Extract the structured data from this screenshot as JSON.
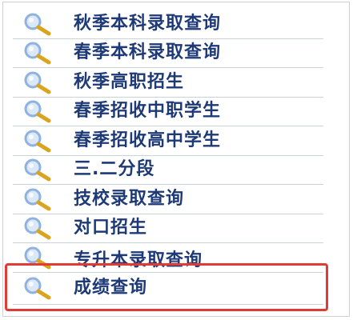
{
  "menu": {
    "items": [
      {
        "label": "秋季本科录取查询",
        "icon": "search-icon"
      },
      {
        "label": "春季本科录取查询",
        "icon": "search-icon"
      },
      {
        "label": "秋季高职招生",
        "icon": "search-icon"
      },
      {
        "label": "春季招收中职学生",
        "icon": "search-icon"
      },
      {
        "label": "春季招收高中学生",
        "icon": "search-icon"
      },
      {
        "label": "三.二分段",
        "icon": "search-icon"
      },
      {
        "label": "技校录取查询",
        "icon": "search-icon"
      },
      {
        "label": "对口招生",
        "icon": "search-icon"
      },
      {
        "label": "专升本录取查询",
        "icon": "search-icon"
      },
      {
        "label": "成绩查询",
        "icon": "search-icon"
      }
    ]
  },
  "colors": {
    "label_text": "#1d3a77",
    "divider": "#c9d3dc",
    "highlight_border": "#e13b34",
    "magnifier_lens": "#8fb2de",
    "magnifier_handle": "#d9a520"
  }
}
